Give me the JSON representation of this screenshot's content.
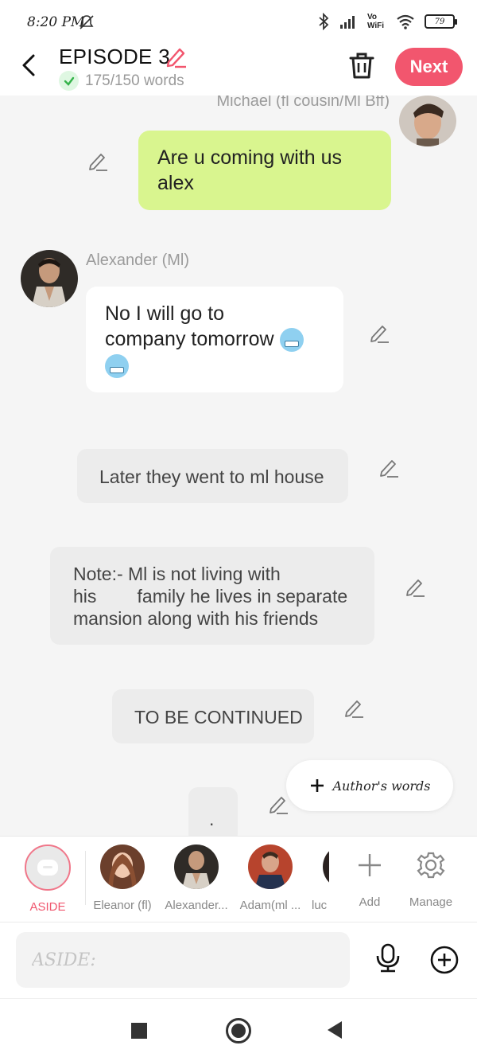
{
  "status": {
    "time": "8:20 PM",
    "volte": "Vo WiFi",
    "battery": "79"
  },
  "header": {
    "title": "EPISODE 3",
    "word_count": "175/150 words",
    "next_label": "Next"
  },
  "messages": [
    {
      "type": "right",
      "speaker": "Michael (fl cousin/Ml Bff)",
      "text_line1": "Are u coming with us",
      "text_line2": "alex"
    },
    {
      "type": "left",
      "speaker": "Alexander (Ml)",
      "text_line1": "No I will go to",
      "text_line2": "company tomorrow"
    },
    {
      "type": "aside",
      "text": "Later they went to ml house"
    },
    {
      "type": "aside",
      "line1": "Note:- Ml is not living with",
      "line2": "his        family he lives in separate",
      "line3": "mansion along with his friends"
    },
    {
      "type": "aside",
      "text": "TO BE CONTINUED"
    },
    {
      "type": "aside",
      "text": "."
    }
  ],
  "authors_words_label": "Author's words",
  "characters": [
    {
      "label": "ASIDE"
    },
    {
      "label": "Eleanor (fl)"
    },
    {
      "label": "Alexander..."
    },
    {
      "label": "Adam(ml ..."
    },
    {
      "label": "luc"
    },
    {
      "label": "Add"
    },
    {
      "label": "Manage"
    }
  ],
  "input": {
    "placeholder": "ASIDE:"
  },
  "colors": {
    "accent": "#f2566e",
    "green_bubble": "#d9f58f",
    "aside_bg": "#ececec"
  }
}
